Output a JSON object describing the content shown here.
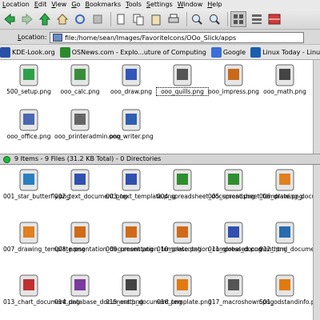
{
  "menubar": [
    "Location",
    "Edit",
    "View",
    "Go",
    "Bookmarks",
    "Tools",
    "Settings",
    "Window",
    "Help"
  ],
  "location": {
    "label": "Location:",
    "value": "file:/home/sean/Images/FavoriteIcons/OOo_Slick/apps"
  },
  "bookmarks": [
    {
      "label": "KDE-Look.org",
      "color": "#2a4fa8"
    },
    {
      "label": "OSNews.com - Explo...uture of Computing",
      "color": "#2c8a2c"
    },
    {
      "label": "Google",
      "color": "#3a6fd8"
    },
    {
      "label": "Linux Today - Linu...",
      "color": "#1a5eb0"
    }
  ],
  "top_files": [
    {
      "label": "500_setup.png",
      "icon": "setup-icon",
      "color": "#2da04a"
    },
    {
      "label": "ooo_calc.png",
      "icon": "calc-icon",
      "color": "#3a8c3a"
    },
    {
      "label": "ooo_draw.png",
      "icon": "draw-icon",
      "color": "#3257b8"
    },
    {
      "label": "ooo_quills.png",
      "icon": "quills-icon",
      "color": "#555555",
      "selected": true
    },
    {
      "label": "ooo_impress.png",
      "icon": "impress-icon",
      "color": "#c86a1a"
    },
    {
      "label": "ooo_math.png",
      "icon": "math-icon",
      "color": "#444444"
    },
    {
      "label": "ooo_office.png",
      "icon": "office-icon",
      "color": "#4a68b0"
    },
    {
      "label": "ooo_printeradmin.png",
      "icon": "printeradmin-icon",
      "color": "#666666"
    },
    {
      "label": "ooo_writer.png",
      "icon": "writer-icon",
      "color": "#2f5fb0"
    }
  ],
  "status_text": "9 Items - 9 Files (31.2 KB Total) - 0 Directories",
  "bottom_files": [
    {
      "label": "001_star_butterfly.png",
      "icon": "butterfly-icon",
      "color": "#2a7fc0"
    },
    {
      "label": "002_text_document.png",
      "icon": "text-document-icon",
      "color": "#3050b0"
    },
    {
      "label": "003_text_template.png",
      "icon": "text-template-icon",
      "color": "#3050b0"
    },
    {
      "label": "004_spreadsheet_document.png",
      "icon": "spreadsheet-document-icon",
      "color": "#2f8f2f"
    },
    {
      "label": "005_spreadsheet_template.png",
      "icon": "spreadsheet-template-icon",
      "color": "#2f8f2f"
    },
    {
      "label": "006_drawing_document.png",
      "icon": "drawing-document-icon",
      "color": "#e08020"
    },
    {
      "label": "007_drawing_template.png",
      "icon": "drawing-template-icon",
      "color": "#e08020"
    },
    {
      "label": "008_presentation_document.png",
      "icon": "presentation-document-icon",
      "color": "#d06a18"
    },
    {
      "label": "009_presentation_template.png",
      "icon": "presentation-template-icon",
      "color": "#d06a18"
    },
    {
      "label": "010_presentation_compressed.png",
      "icon": "presentation-compressed-icon",
      "color": "#d06a18"
    },
    {
      "label": "011_global_document.png",
      "icon": "global-document-icon",
      "color": "#3050b0"
    },
    {
      "label": "012_html_document.png",
      "icon": "html-document-icon",
      "color": "#2a6ab0"
    },
    {
      "label": "013_chart_document.png",
      "icon": "chart-document-icon",
      "color": "#c03030"
    },
    {
      "label": "014_database_document.png",
      "icon": "database-document-icon",
      "color": "#7a3aa0"
    },
    {
      "label": "015_math_document.png",
      "icon": "math-document-icon",
      "color": "#444444"
    },
    {
      "label": "016_template.png",
      "icon": "template-icon",
      "color": "#e07a10"
    },
    {
      "label": "017_macroshown.png",
      "icon": "macroshown-icon",
      "color": "#555555"
    },
    {
      "label": "501_odstandinfo.png",
      "icon": "odstandinfo-icon",
      "color": "#e07a10"
    }
  ]
}
